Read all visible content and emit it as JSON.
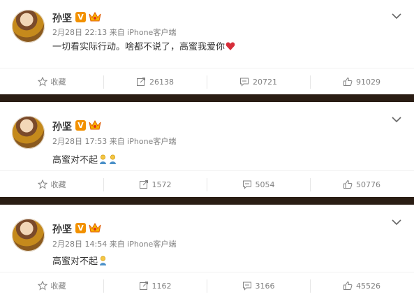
{
  "posts": [
    {
      "user": "孙坚",
      "vip_badge": "V",
      "meta": "2月28日 22:13 来自 iPhone客户端",
      "content": "一切看实际行动。啥都不说了，高蜜我爱你",
      "content_emoji": [
        "heart-icon"
      ],
      "actions": {
        "favorite": "收藏",
        "repost": "26138",
        "comment": "20721",
        "like": "91029"
      }
    },
    {
      "user": "孙坚",
      "vip_badge": "V",
      "meta": "2月28日 17:53 来自 iPhone客户端",
      "content": "高蜜对不起",
      "content_emoji": [
        "kneel-emoji-icon",
        "kneel-emoji-icon"
      ],
      "actions": {
        "favorite": "收藏",
        "repost": "1572",
        "comment": "5054",
        "like": "50776"
      }
    },
    {
      "user": "孙坚",
      "vip_badge": "V",
      "meta": "2月28日 14:54 来自 iPhone客户端",
      "content": "高蜜对不起",
      "content_emoji": [
        "kneel-emoji-icon"
      ],
      "actions": {
        "favorite": "收藏",
        "repost": "1162",
        "comment": "3166",
        "like": "45526"
      }
    }
  ],
  "colors": {
    "vip_badge": "#f29100",
    "divider": "#2a1d14",
    "meta_text": "#808080",
    "heart": "#d62e3a"
  }
}
